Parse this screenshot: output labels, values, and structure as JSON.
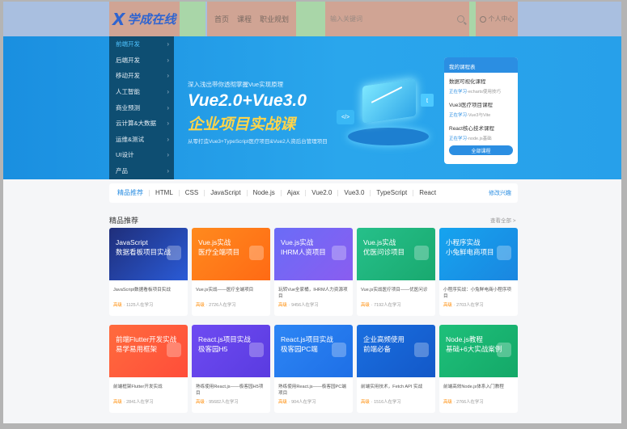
{
  "header": {
    "logo_mark": "X",
    "logo_text": "学成在线",
    "nav": [
      "首页",
      "课程",
      "职业规划"
    ],
    "search_placeholder": "输入关键词",
    "login_label": "个人中心"
  },
  "banner": {
    "menu": [
      {
        "label": "前端开发",
        "active": true
      },
      {
        "label": "后端开发"
      },
      {
        "label": "移动开发"
      },
      {
        "label": "人工智能"
      },
      {
        "label": "商业预测"
      },
      {
        "label": "云计算&大数据"
      },
      {
        "label": "运维&测试"
      },
      {
        "label": "UI设计"
      },
      {
        "label": "产品"
      }
    ],
    "subtitle": "深入浅出带你透彻掌握Vue实现原理",
    "title1": "Vue2.0+Vue3.0",
    "title2": "企业项目实战课",
    "desc": "从零打造Vue3+TypeScript医疗项目&Vue2人资后台管理项目",
    "illus_code": "</>",
    "illus_t": "t",
    "panel": {
      "title": "我的课程表",
      "items": [
        {
          "title": "数据可视化课程",
          "progress": "正在学习",
          "sub": "-echarts使用技巧"
        },
        {
          "title": "Vue3医疗项目课程",
          "progress": "正在学习",
          "sub": "-Vue3与Vite"
        },
        {
          "title": "React核心技术课程",
          "progress": "正在学习",
          "sub": "-node.js基础"
        }
      ],
      "button": "全部课程"
    }
  },
  "tags": {
    "items": [
      "精品推荐",
      "HTML",
      "CSS",
      "JavaScript",
      "Node.js",
      "Ajax",
      "Vue2.0",
      "Vue3.0",
      "TypeScript",
      "React"
    ],
    "edit": "修改兴趣"
  },
  "section": {
    "title": "精品推荐",
    "more": "查看全部 >"
  },
  "colors": {
    "banner_bg": "#1a8fe0",
    "side_menu_bg": "#0e4e72",
    "accent": "#2b8ee2",
    "level": "#ff8a00"
  },
  "cards": [
    {
      "img_text": "JavaScript\n数据看板项目实战",
      "bg": "linear-gradient(135deg,#1f2e7a,#2a5bd7)",
      "title": "JavaScript数据看板项目实战",
      "level": "高级",
      "count": "· 1125人在学习"
    },
    {
      "img_text": "Vue.js实战\n医疗全端项目",
      "bg": "linear-gradient(135deg,#ff8a1e,#ff6a14)",
      "title": "Vue.js实战——医疗全端项目",
      "level": "高级",
      "count": "· 2726人在学习"
    },
    {
      "img_text": "Vue.js实战\nIHRM人资项目",
      "bg": "linear-gradient(135deg,#6a6cf7,#8a5df0)",
      "title": "玩转Vue全家桶，IHRM人力资源项目",
      "level": "高级",
      "count": "· 9456人在学习"
    },
    {
      "img_text": "Vue.js实战\n优医问诊项目",
      "bg": "linear-gradient(135deg,#26c08a,#19a96f)",
      "title": "Vue.js实战医疗项目——优医问诊",
      "level": "高级",
      "count": "· 7192人在学习"
    },
    {
      "img_text": "小程序实战\n小兔鲜电商项目",
      "bg": "linear-gradient(135deg,#16a4ef,#1a86e0)",
      "title": "小程序实战：小兔鲜电商小程序项目",
      "level": "高级",
      "count": "· 2703人在学习"
    },
    {
      "img_text": "前端Flutter开发实战\n易学易用框架",
      "bg": "linear-gradient(135deg,#ff6b3d,#ff4d3a)",
      "title": "前端框架Flutter开发实战",
      "level": "高级",
      "count": "· 2841人在学习"
    },
    {
      "img_text": "React.js项目实战\n极客园H5",
      "bg": "linear-gradient(135deg,#6e4bf2,#5a3be0)",
      "title": "熟练使用React.js——极客园H5项目",
      "level": "高级",
      "count": "· 95682人在学习"
    },
    {
      "img_text": "React.js项目实战\n极客园PC端",
      "bg": "linear-gradient(135deg,#2d86f5,#1e6fe6)",
      "title": "熟练使用React.js——极客园PC端项目",
      "level": "高级",
      "count": "· 904人在学习"
    },
    {
      "img_text": "企业高频使用\n前端必备",
      "bg": "linear-gradient(135deg,#1a6fe0,#1358c8)",
      "title": "前端实用技术，Fetch API 实战",
      "level": "高级",
      "count": "· 1516人在学习"
    },
    {
      "img_text": "Node.js教程\n基础+6大实战案例",
      "bg": "linear-gradient(135deg,#1ec07a,#14a868)",
      "title": "前端高效Node.js体系入门教程",
      "level": "高级",
      "count": "· 2766人在学习"
    }
  ]
}
